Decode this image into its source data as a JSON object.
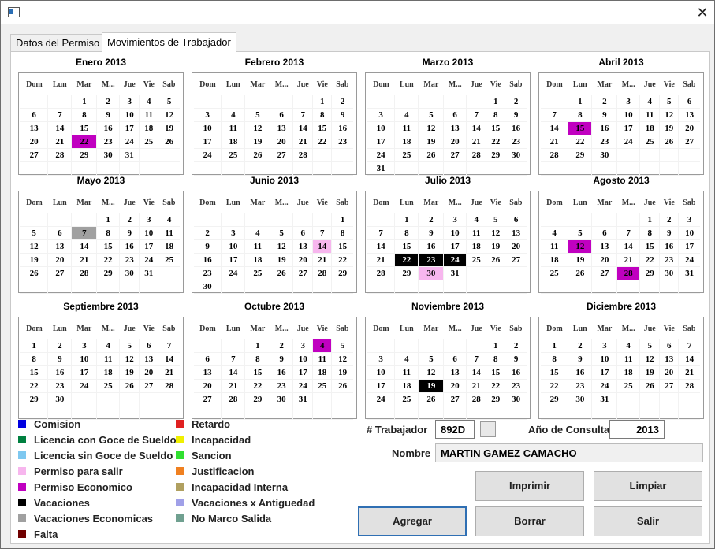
{
  "window": {
    "icon": "app-window-icon",
    "close_glyph": "✕"
  },
  "tabs": [
    {
      "label": "Datos del Permiso",
      "active": false
    },
    {
      "label": "Movimientos de Trabajador",
      "active": true
    }
  ],
  "weekday_headers": [
    "Dom",
    "Lun",
    "Mar",
    "M...",
    "Jue",
    "Vie",
    "Sab"
  ],
  "months": [
    {
      "title": "Enero 2013",
      "start": 2,
      "days": 31,
      "marks": {
        "22": "#c000c0"
      }
    },
    {
      "title": "Febrero 2013",
      "start": 5,
      "days": 28,
      "marks": {}
    },
    {
      "title": "Marzo 2013",
      "start": 5,
      "days": 31,
      "marks": {}
    },
    {
      "title": "Abril 2013",
      "start": 1,
      "days": 30,
      "marks": {
        "15": "#c000c0"
      }
    },
    {
      "title": "Mayo 2013",
      "start": 3,
      "days": 31,
      "marks": {
        "7": "#a0a0a0"
      }
    },
    {
      "title": "Junio 2013",
      "start": 6,
      "days": 30,
      "marks": {
        "14": "#f7b6ee"
      }
    },
    {
      "title": "Julio 2013",
      "start": 1,
      "days": 31,
      "marks": {
        "22": "#000000",
        "23": "#000000",
        "24": "#000000",
        "30": "#f7b6ee"
      }
    },
    {
      "title": "Agosto 2013",
      "start": 4,
      "days": 31,
      "marks": {
        "12": "#c000c0",
        "28": "#c000c0"
      }
    },
    {
      "title": "Septiembre 2013",
      "start": 0,
      "days": 30,
      "marks": {}
    },
    {
      "title": "Octubre 2013",
      "start": 2,
      "days": 31,
      "marks": {
        "4": "#c000c0"
      }
    },
    {
      "title": "Noviembre 2013",
      "start": 5,
      "days": 30,
      "marks": {
        "19": "#000000"
      }
    },
    {
      "title": "Diciembre 2013",
      "start": 0,
      "days": 31,
      "marks": {}
    }
  ],
  "legend": [
    {
      "label": "Comision",
      "color": "#0000e0"
    },
    {
      "label": "Licencia con Goce de Sueldo",
      "color": "#008040"
    },
    {
      "label": "Licencia sin Goce de Sueldo",
      "color": "#7ec8f0"
    },
    {
      "label": "Permiso para salir",
      "color": "#f7b6ee"
    },
    {
      "label": "Permiso Economico",
      "color": "#c000c0"
    },
    {
      "label": "Vacaciones",
      "color": "#000000"
    },
    {
      "label": "Vacaciones Economicas",
      "color": "#a0a0a0"
    },
    {
      "label": "Falta",
      "color": "#700000"
    },
    {
      "label": "Retardo",
      "color": "#e02020"
    },
    {
      "label": "Incapacidad",
      "color": "#f0f000"
    },
    {
      "label": "Sancion",
      "color": "#30e030"
    },
    {
      "label": "Justificacion",
      "color": "#f08020"
    },
    {
      "label": "Incapacidad Interna",
      "color": "#b0a060"
    },
    {
      "label": "Vacaciones x Antiguedad",
      "color": "#a0a0e8"
    },
    {
      "label": "No Marco Salida",
      "color": "#70a090"
    }
  ],
  "form": {
    "trabajador_label": "# Trabajador",
    "trabajador_value": "892D",
    "anio_label": "Año de Consulta",
    "anio_value": "2013",
    "nombre_label": "Nombre",
    "nombre_value": "MARTIN GAMEZ CAMACHO"
  },
  "buttons": {
    "imprimir": "Imprimir",
    "limpiar": "Limpiar",
    "agregar": "Agregar",
    "borrar": "Borrar",
    "salir": "Salir"
  }
}
